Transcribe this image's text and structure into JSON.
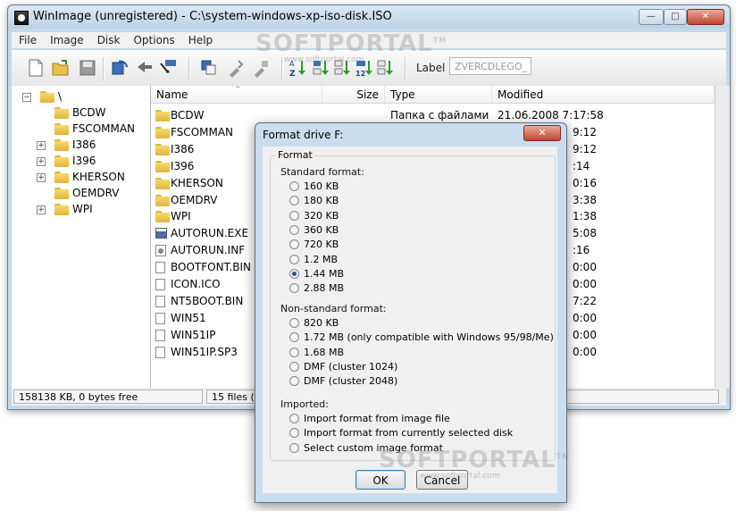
{
  "window": {
    "title": "WinImage (unregistered) - C:\\system-windows-xp-iso-disk.ISO",
    "controls": {
      "minimize": "—",
      "maximize": "□",
      "close": "✕"
    }
  },
  "menu": [
    "File",
    "Image",
    "Disk",
    "Options",
    "Help"
  ],
  "toolbar": {
    "label_caption": "Label :",
    "label_value": "ZVERCDLEGO_"
  },
  "tree": {
    "root": "\\",
    "items": [
      {
        "label": "BCDW",
        "expandable": false
      },
      {
        "label": "FSCOMMAN",
        "expandable": false
      },
      {
        "label": "I386",
        "expandable": true
      },
      {
        "label": "I396",
        "expandable": true
      },
      {
        "label": "KHERSON",
        "expandable": true
      },
      {
        "label": "OEMDRV",
        "expandable": false
      },
      {
        "label": "WPI",
        "expandable": true
      }
    ]
  },
  "list": {
    "columns": {
      "name": "Name",
      "size": "Size",
      "type": "Type",
      "modified": "Modified"
    },
    "rows": [
      {
        "name": "BCDW",
        "kind": "folder",
        "type": "Папка с файлами",
        "modified": "21.06.2008  7:17:58"
      },
      {
        "name": "FSCOMMAN",
        "kind": "folder",
        "type": "",
        "modified": "9:12"
      },
      {
        "name": "I386",
        "kind": "folder",
        "type": "",
        "modified": "9:12"
      },
      {
        "name": "I396",
        "kind": "folder",
        "type": "",
        "modified": ":14"
      },
      {
        "name": "KHERSON",
        "kind": "folder",
        "type": "",
        "modified": "0:16"
      },
      {
        "name": "OEMDRV",
        "kind": "folder",
        "type": "",
        "modified": "3:38"
      },
      {
        "name": "WPI",
        "kind": "folder",
        "type": "",
        "modified": "1:38"
      },
      {
        "name": "AUTORUN.EXE",
        "kind": "exe",
        "type": "",
        "modified": "5:08"
      },
      {
        "name": "AUTORUN.INF",
        "kind": "gear",
        "type": "",
        "modified": ":16"
      },
      {
        "name": "BOOTFONT.BIN",
        "kind": "file",
        "type": "",
        "modified": "0:00"
      },
      {
        "name": "ICON.ICO",
        "kind": "file",
        "type": "",
        "modified": "0:00"
      },
      {
        "name": "NT5BOOT.BIN",
        "kind": "file",
        "type": "",
        "modified": "7:22"
      },
      {
        "name": "WIN51",
        "kind": "file",
        "type": "",
        "modified": "0:00"
      },
      {
        "name": "WIN51IP",
        "kind": "file",
        "type": "",
        "modified": "0:00"
      },
      {
        "name": "WIN51IP.SP3",
        "kind": "file",
        "type": "",
        "modified": "0:00"
      }
    ]
  },
  "status": {
    "left": "158138 KB, 0 bytes free",
    "right": "15 files (3 6"
  },
  "dialog": {
    "title": "Format drive F:",
    "close": "✕",
    "group_label": "Format",
    "standard_label": "Standard format:",
    "standard": [
      "160 KB",
      "180 KB",
      "320 KB",
      "360 KB",
      "720 KB",
      "1.2 MB",
      "1.44 MB",
      "2.88 MB"
    ],
    "selected": "1.44 MB",
    "nonstandard_label": "Non-standard format:",
    "nonstandard": [
      "820 KB",
      "1.72 MB (only compatible with Windows 95/98/Me)",
      "1.68 MB",
      "DMF (cluster 1024)",
      "DMF (cluster 2048)"
    ],
    "imported_label": "Imported:",
    "imported": [
      "Import format from image file",
      "Import format from currently selected disk",
      "Select custom image format"
    ],
    "ok": "OK",
    "cancel": "Cancel"
  },
  "watermark": {
    "brand": "SOFTPORTAL",
    "tm": "TM",
    "url": "www.softportal.com"
  }
}
